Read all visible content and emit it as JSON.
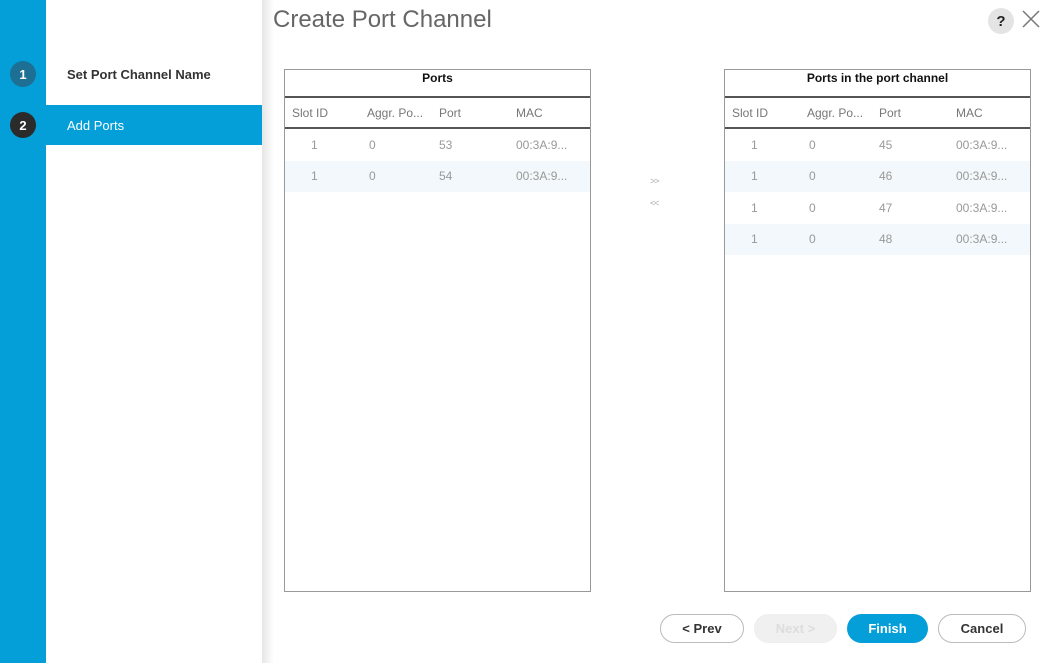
{
  "dialog": {
    "title": "Create Port Channel",
    "help_label": "?"
  },
  "steps": [
    {
      "number": "1",
      "label": "Set Port Channel Name",
      "active": false
    },
    {
      "number": "2",
      "label": "Add Ports",
      "active": true
    }
  ],
  "ports_table": {
    "title": "Ports",
    "columns": [
      "Slot ID",
      "Aggr. Po...",
      "Port",
      "MAC"
    ],
    "rows": [
      [
        "1",
        "0",
        "53",
        "00:3A:9..."
      ],
      [
        "1",
        "0",
        "54",
        "00:3A:9..."
      ]
    ]
  },
  "channel_table": {
    "title": "Ports in the port channel",
    "columns": [
      "Slot ID",
      "Aggr. Po...",
      "Port",
      "MAC"
    ],
    "rows": [
      [
        "1",
        "0",
        "45",
        "00:3A:9..."
      ],
      [
        "1",
        "0",
        "46",
        "00:3A:9..."
      ],
      [
        "1",
        "0",
        "47",
        "00:3A:9..."
      ],
      [
        "1",
        "0",
        "48",
        "00:3A:9..."
      ]
    ]
  },
  "transfer": {
    "add_label": ">>",
    "remove_label": "<<"
  },
  "buttons": {
    "prev": "< Prev",
    "next": "Next >",
    "finish": "Finish",
    "cancel": "Cancel"
  },
  "colors": {
    "accent": "#049fd9"
  }
}
